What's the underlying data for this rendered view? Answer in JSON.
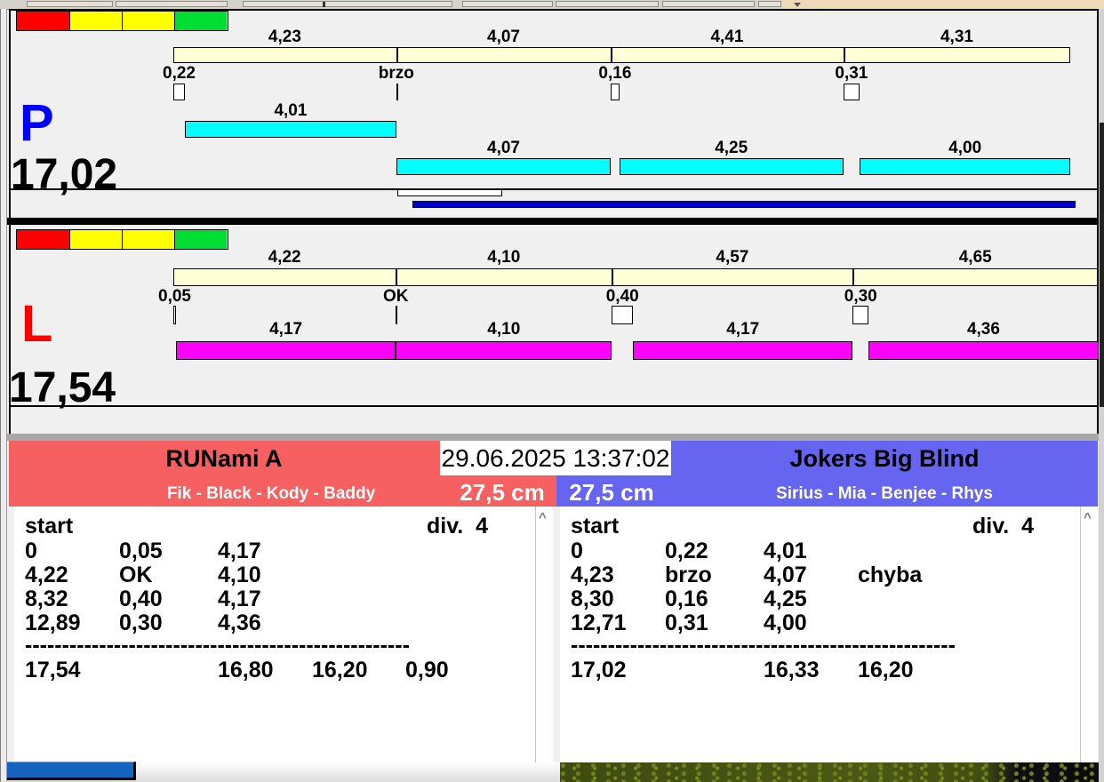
{
  "clock": "29.06.2025 13:37:02",
  "icons": {
    "scroll_up": "^"
  },
  "colors": {
    "cream": "#ffffd6",
    "progress_blue": "#0000cc",
    "red_panel": "#f76060",
    "blue_panel": "#6565f1",
    "grey_strip": "#a8a8a8"
  },
  "lights": [
    {
      "name": "red",
      "color": "#ff0000"
    },
    {
      "name": "yellow",
      "color": "#ffff00"
    },
    {
      "name": "yellow",
      "color": "#ffff00"
    },
    {
      "name": "green",
      "color": "#00dd33"
    }
  ],
  "lanes": {
    "P": {
      "letter": "P",
      "letter_color": "#0000ff",
      "total": "17,02",
      "bar_color": "#00ffff",
      "splits": [
        {
          "split_label": "4,23",
          "split_s": 4.23,
          "gap_label": "0,22",
          "gap_s": 0.22,
          "gap_style": "box",
          "dog_label": "4,01",
          "dog_s": 4.01,
          "bar_row": 0
        },
        {
          "split_label": "4,07",
          "split_s": 4.07,
          "gap_label": "brzo",
          "gap_s": 0,
          "gap_style": "tick",
          "dog_label": "4,07",
          "dog_s": 4.07,
          "bar_row": 1
        },
        {
          "split_label": "4,41",
          "split_s": 4.41,
          "gap_label": "0,16",
          "gap_s": 0.16,
          "gap_style": "box",
          "dog_label": "4,25",
          "dog_s": 4.25,
          "bar_row": 1
        },
        {
          "split_label": "4,31",
          "split_s": 4.31,
          "gap_label": "0,31",
          "gap_s": 0.31,
          "gap_style": "box",
          "dog_label": "4,00",
          "dog_s": 4.0,
          "bar_row": 1
        }
      ]
    },
    "L": {
      "letter": "L",
      "letter_color": "#ff0000",
      "total": "17,54",
      "bar_color": "#ff00ff",
      "splits": [
        {
          "split_label": "4,22",
          "split_s": 4.22,
          "gap_label": "0,05",
          "gap_s": 0.05,
          "gap_style": "box",
          "dog_label": "4,17",
          "dog_s": 4.17,
          "bar_row": 0
        },
        {
          "split_label": "4,10",
          "split_s": 4.1,
          "gap_label": "OK",
          "gap_s": 0,
          "gap_style": "tick",
          "dog_label": "4,10",
          "dog_s": 4.1,
          "bar_row": 0
        },
        {
          "split_label": "4,57",
          "split_s": 4.57,
          "gap_label": "0,40",
          "gap_s": 0.4,
          "gap_style": "box",
          "dog_label": "4,17",
          "dog_s": 4.17,
          "bar_row": 0
        },
        {
          "split_label": "4,65",
          "split_s": 4.65,
          "gap_label": "0,30",
          "gap_s": 0.3,
          "gap_style": "box",
          "dog_label": "4,36",
          "dog_s": 4.36,
          "bar_row": 0
        }
      ]
    }
  },
  "teams": {
    "left": {
      "name": "RUNami A",
      "dogs": "Fik - Black - Kody - Baddy",
      "jump_height": "27,5 cm",
      "table": {
        "header_left": "start",
        "header_right": "div.  4",
        "rows": [
          [
            "0",
            "0,05",
            "4,17",
            ""
          ],
          [
            "4,22",
            "OK",
            "4,10",
            ""
          ],
          [
            "8,32",
            "0,40",
            "4,17",
            ""
          ],
          [
            "12,89",
            "0,30",
            "4,36",
            ""
          ]
        ],
        "separator": "----------------------------------------------------",
        "totals": [
          "17,54",
          "16,80",
          "16,20",
          "0,90"
        ]
      }
    },
    "right": {
      "name": "Jokers Big Blind",
      "dogs": "Sirius - Mia - Benjee - Rhys",
      "jump_height": "27,5 cm",
      "table": {
        "header_left": "start",
        "header_right": "div.  4",
        "rows": [
          [
            "0",
            "0,22",
            "4,01",
            ""
          ],
          [
            "4,23",
            "brzo",
            "4,07",
            "chyba"
          ],
          [
            "8,30",
            "0,16",
            "4,25",
            ""
          ],
          [
            "12,71",
            "0,31",
            "4,00",
            ""
          ]
        ],
        "separator": "----------------------------------------------------",
        "totals": [
          "17,02",
          "16,33",
          "16,20",
          ""
        ]
      }
    }
  }
}
